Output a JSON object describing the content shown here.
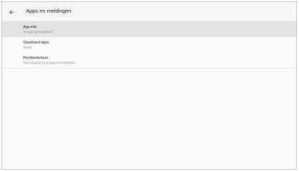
{
  "toolbar": {
    "back_icon": "arrow-left-icon",
    "title": "Apps en meldingen"
  },
  "settings": [
    {
      "title": "App-info",
      "subtitle": "20 apps geïnstalleerd",
      "selected": true
    },
    {
      "title": "Standaard apps",
      "subtitle": "Opera",
      "selected": false
    },
    {
      "title": "Rechtenbeheer",
      "subtitle": "App-toegang tot je gegevens beheren",
      "selected": false
    }
  ],
  "colors": {
    "background": "#fafafa",
    "selected_row": "#e3e3e3",
    "text_primary": "#202020",
    "text_secondary": "#8a8a8a"
  }
}
